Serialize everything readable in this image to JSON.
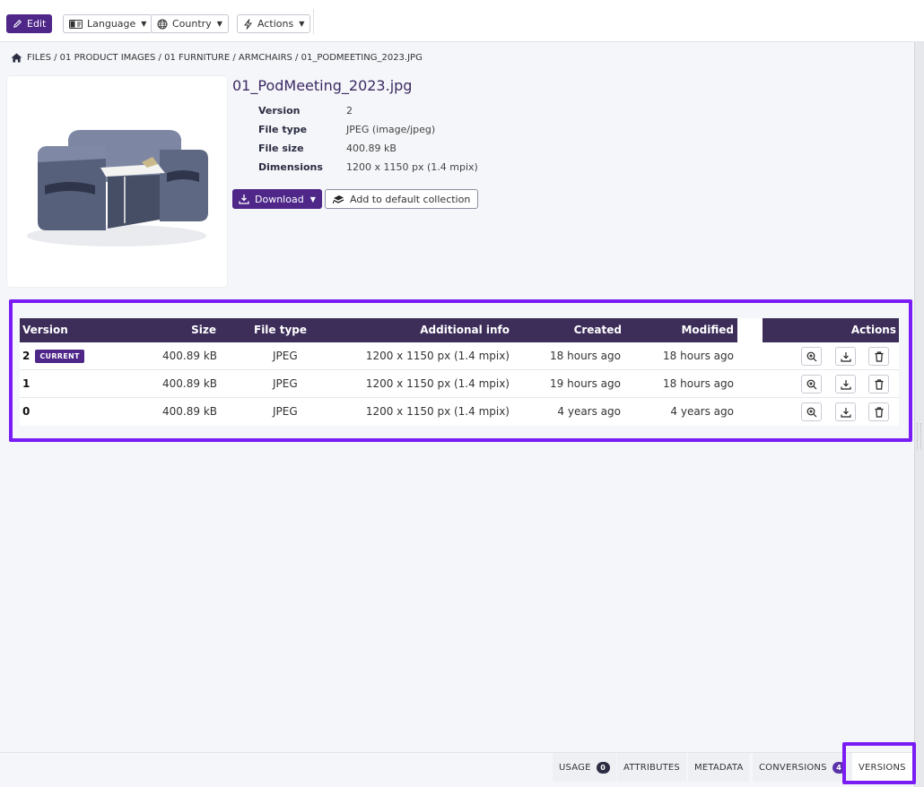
{
  "toolbar": {
    "edit": "Edit",
    "language": "Language",
    "country": "Country",
    "actions": "Actions"
  },
  "breadcrumb": "FILES / 01 PRODUCT IMAGES / 01 FURNITURE / ARMCHAIRS / 01_PODMEETING_2023.JPG",
  "file": {
    "name": "01_PodMeeting_2023.jpg",
    "meta": [
      {
        "key": "Version",
        "value": "2"
      },
      {
        "key": "File type",
        "value": "JPEG (image/jpeg)"
      },
      {
        "key": "File size",
        "value": "400.89 kB"
      },
      {
        "key": "Dimensions",
        "value": "1200 x 1150 px (1.4 mpix)"
      }
    ],
    "download_label": "Download",
    "collection_label": "Add to default collection"
  },
  "versions": {
    "headers": {
      "version": "Version",
      "size": "Size",
      "file_type": "File type",
      "additional_info": "Additional info",
      "created": "Created",
      "modified": "Modified",
      "actions": "Actions"
    },
    "current_badge": "CURRENT",
    "rows": [
      {
        "version": "2",
        "size": "400.89 kB",
        "type": "JPEG",
        "info": "1200 x 1150 px (1.4 mpix)",
        "created": "18 hours ago",
        "modified": "18 hours ago"
      },
      {
        "version": "1",
        "size": "400.89 kB",
        "type": "JPEG",
        "info": "1200 x 1150 px (1.4 mpix)",
        "created": "19 hours ago",
        "modified": "18 hours ago"
      },
      {
        "version": "0",
        "size": "400.89 kB",
        "type": "JPEG",
        "info": "1200 x 1150 px (1.4 mpix)",
        "created": "4 years ago",
        "modified": "4 years ago"
      }
    ]
  },
  "tabs": {
    "usage": "USAGE",
    "usage_count": "0",
    "attributes": "ATTRIBUTES",
    "metadata": "METADATA",
    "conversions": "CONVERSIONS",
    "conversions_count": "4",
    "versions": "VERSIONS"
  },
  "colors": {
    "brand": "#4e2789",
    "header": "#3c2d59",
    "highlight": "#7a1cf5"
  }
}
